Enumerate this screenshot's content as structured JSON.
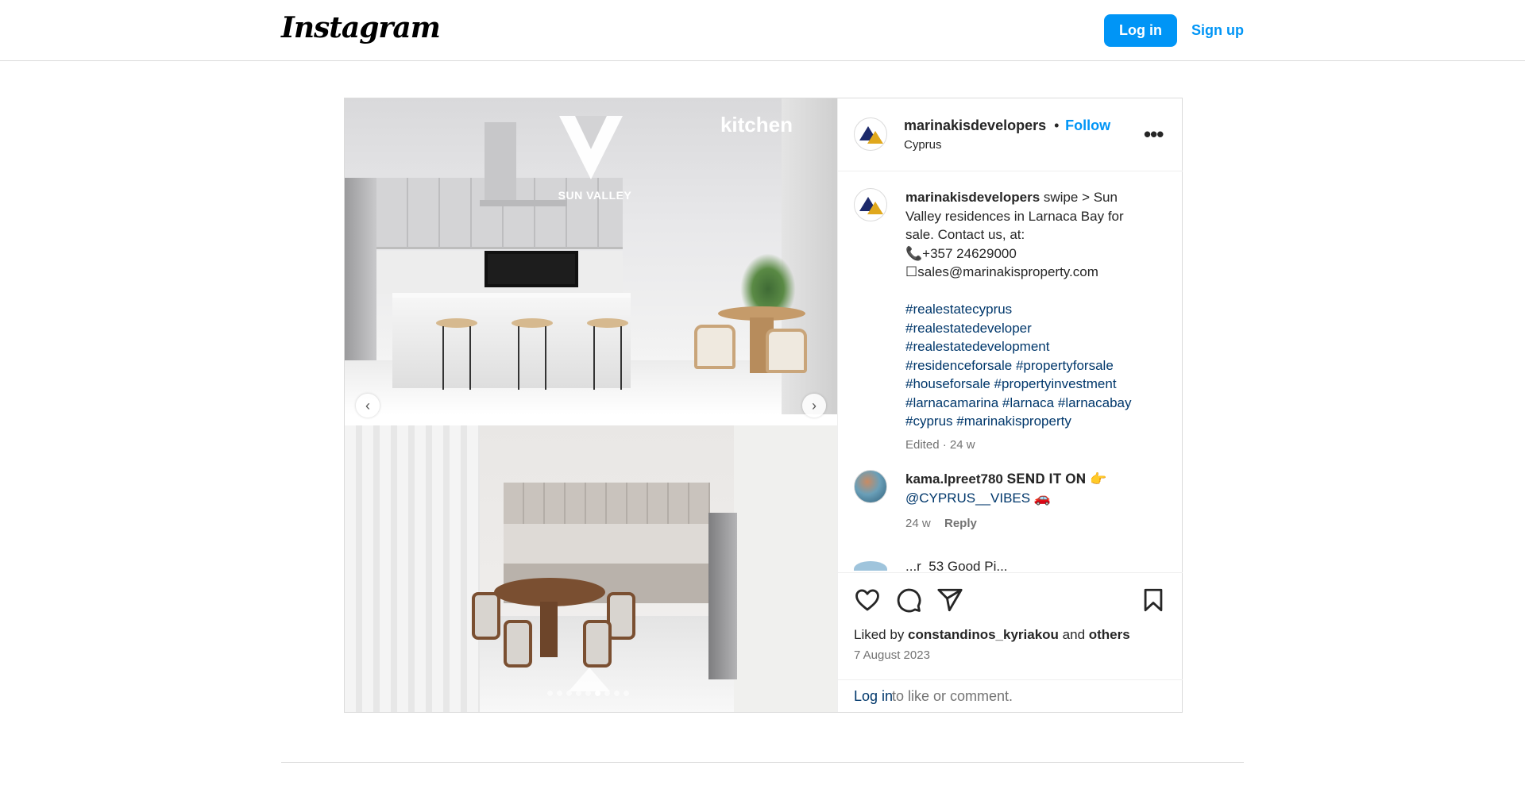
{
  "header": {
    "logo": "Instagram",
    "login_label": "Log in",
    "signup_label": "Sign up"
  },
  "post": {
    "media": {
      "brand_name": "SUN VALLEY",
      "image_label": "kitchen",
      "carousel": {
        "total_dots": 9,
        "active_index": 5
      }
    },
    "author": {
      "username": "marinakisdevelopers",
      "separator": "•",
      "follow_label": "Follow",
      "location": "Cyprus"
    },
    "caption": {
      "username": "marinakisdevelopers",
      "line1": " swipe > Sun Valley residences in Larnaca Bay for sale. Contact us, at:",
      "phone": "📞+357 24629000",
      "email": "☐sales@marinakisproperty.com",
      "hashtags": [
        "#realestatecyprus",
        "#realestatedeveloper",
        "#realestatedevelopment",
        "#residenceforsale",
        "#propertyforsale",
        "#houseforsale",
        "#propertyinvestment",
        "#larnacamarina",
        "#larnaca",
        "#larnacabay",
        "#cyprus",
        "#marinakisproperty"
      ],
      "meta": "Edited · 24 w"
    },
    "comments": [
      {
        "username": "kama.lpreet780",
        "text": "𝐒𝐄𝐍𝐃 𝐈𝐓 𝐎𝐍 👉",
        "mention": "@CYPRUS__VIBES 🚗",
        "age": "24 w",
        "reply_label": "Reply"
      }
    ],
    "peek_comment": "...r_53 Good Pi...",
    "liked_by_prefix": "Liked by ",
    "liked_by_user": "constandinos_kyriakou",
    "liked_by_and": " and ",
    "liked_by_others": "others",
    "date": "7 August 2023",
    "login_link": "Log in",
    "login_rest": " to like or comment."
  }
}
